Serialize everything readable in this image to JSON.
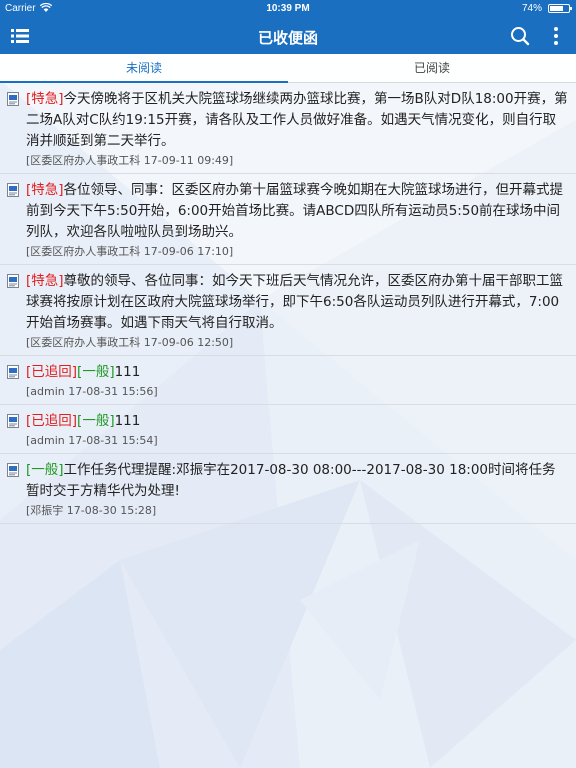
{
  "status_bar": {
    "carrier": "Carrier",
    "time": "10:39 PM",
    "battery": "74%",
    "battery_level": 0.74
  },
  "nav": {
    "title": "已收便函",
    "icons": {
      "menu": "list-menu-icon",
      "search": "search-icon",
      "more": "more-vertical-icon"
    }
  },
  "tabs": [
    {
      "label": "未阅读",
      "active": true
    },
    {
      "label": "已阅读",
      "active": false
    }
  ],
  "messages": [
    {
      "tags": [
        {
          "text": "[特急]",
          "kind": "urgent"
        }
      ],
      "body": "今天傍晚将于区机关大院篮球场继续两办篮球比赛，第一场B队对D队18:00开赛，第二场A队对C队约19:15开赛，请各队及工作人员做好准备。如遇天气情况变化，则自行取消并顺延到第二天举行。",
      "meta": "[区委区府办人事政工科 17-09-11 09:49]"
    },
    {
      "tags": [
        {
          "text": "[特急]",
          "kind": "urgent"
        }
      ],
      "body": "各位领导、同事：区委区府办第十届篮球赛今晚如期在大院篮球场进行，但开幕式提前到今天下午5:50开始，6:00开始首场比赛。请ABCD四队所有运动员5:50前在球场中间列队，欢迎各队啦啦队员到场助兴。",
      "meta": "[区委区府办人事政工科 17-09-06 17:10]"
    },
    {
      "tags": [
        {
          "text": "[特急]",
          "kind": "urgent"
        }
      ],
      "body": "尊敬的领导、各位同事：如今天下班后天气情况允许，区委区府办第十届干部职工篮球赛将按原计划在区政府大院篮球场举行，即下午6:50各队运动员列队进行开幕式，7:00开始首场赛事。如遇下雨天气将自行取消。",
      "meta": "[区委区府办人事政工科 17-09-06 12:50]"
    },
    {
      "tags": [
        {
          "text": "[已追回]",
          "kind": "recalled"
        },
        {
          "text": "[一般]",
          "kind": "normal"
        }
      ],
      "body": "111",
      "meta": "[admin 17-08-31 15:56]"
    },
    {
      "tags": [
        {
          "text": "[已追回]",
          "kind": "recalled"
        },
        {
          "text": "[一般]",
          "kind": "normal"
        }
      ],
      "body": "111",
      "meta": "[admin 17-08-31 15:54]"
    },
    {
      "tags": [
        {
          "text": "[一般]",
          "kind": "normal"
        }
      ],
      "body": "工作任务代理提醒:邓振宇在2017-08-30 08:00---2017-08-30 18:00时间将任务暂时交于方精华代为处理!",
      "meta": "[邓振宇 17-08-30 15:28]"
    }
  ]
}
